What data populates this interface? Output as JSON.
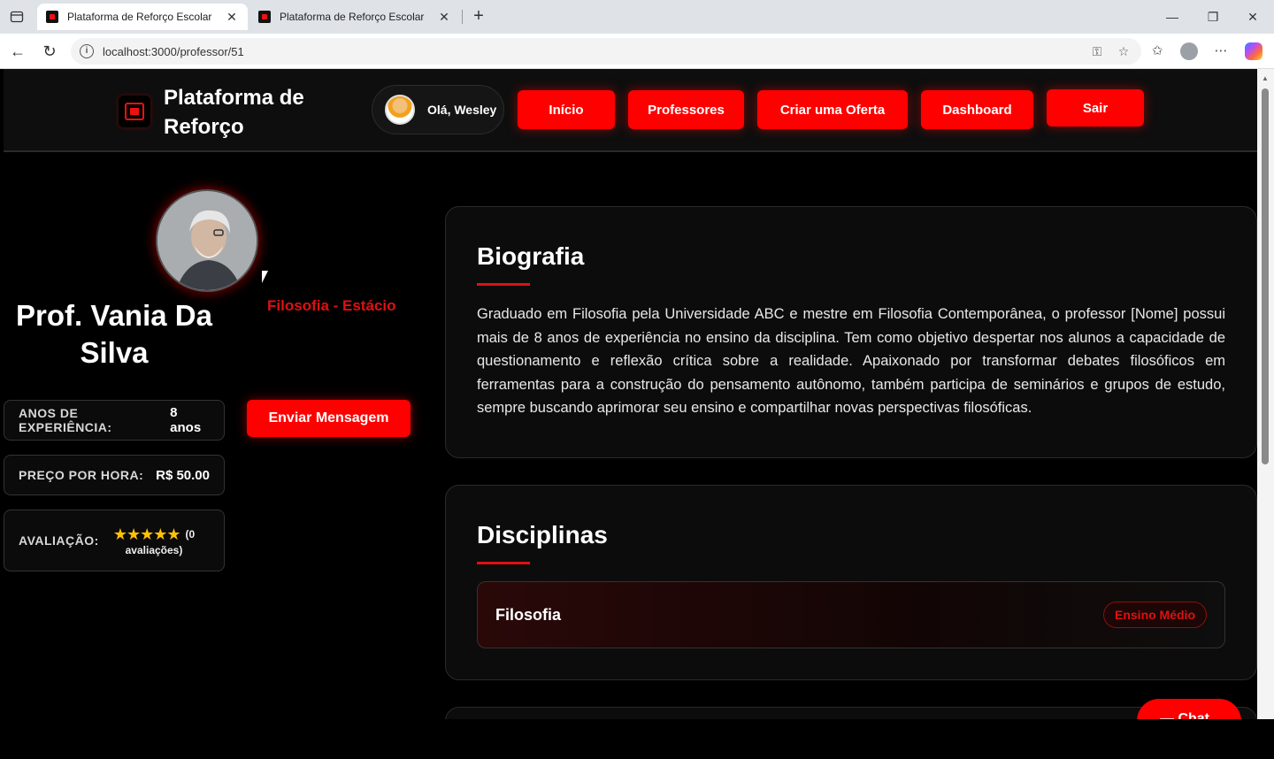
{
  "browser": {
    "tabs": [
      {
        "title": "Plataforma de Reforço Escolar",
        "close": "✕"
      },
      {
        "title": "Plataforma de Reforço Escolar",
        "close": "✕"
      }
    ],
    "new_tab": "+",
    "url": "localhost:3000/professor/51",
    "window_controls": {
      "minimize": "—",
      "restore": "❐",
      "close": "✕"
    }
  },
  "header": {
    "brand": "Plataforma de Reforço",
    "greeting": "Olá, Wesley",
    "nav": {
      "home": "Início",
      "teachers": "Professores",
      "create_offer": "Criar uma Oferta",
      "dashboard": "Dashboard",
      "logout": "Sair"
    }
  },
  "profile": {
    "name": "Prof. Vania Da Silva",
    "subject_institution": "Filosofia - Estácio",
    "experience_label": "ANOS DE EXPERIÊNCIA:",
    "experience_value": "8 anos",
    "price_label": "PREÇO POR HORA:",
    "price_value": "R$ 50.00",
    "rating_label": "AVALIAÇÃO:",
    "rating_stars": "★★★★★",
    "rating_count_open": "(0",
    "rating_count_close": "avaliações)",
    "message_button": "Enviar Mensagem"
  },
  "biography": {
    "title": "Biografia",
    "text": "Graduado em Filosofia pela Universidade ABC e mestre em Filosofia Contemporânea, o professor [Nome] possui mais de 8 anos de experiência no ensino da disciplina. Tem como objetivo despertar nos alunos a capacidade de questionamento e reflexão crítica sobre a realidade. Apaixonado por transformar debates filosóficos em ferramentas para a construção do pensamento autônomo, também participa de seminários e grupos de estudo, sempre buscando aprimorar seu ensino e compartilhar novas perspectivas filosóficas."
  },
  "disciplines": {
    "title": "Disciplinas",
    "items": [
      {
        "name": "Filosofia",
        "level": "Ensino Médio"
      }
    ]
  },
  "chat": {
    "label": "Chat"
  },
  "colors": {
    "accent": "#ff0000",
    "accent_text": "#e01010",
    "background": "#000000",
    "star": "#ffc107"
  }
}
